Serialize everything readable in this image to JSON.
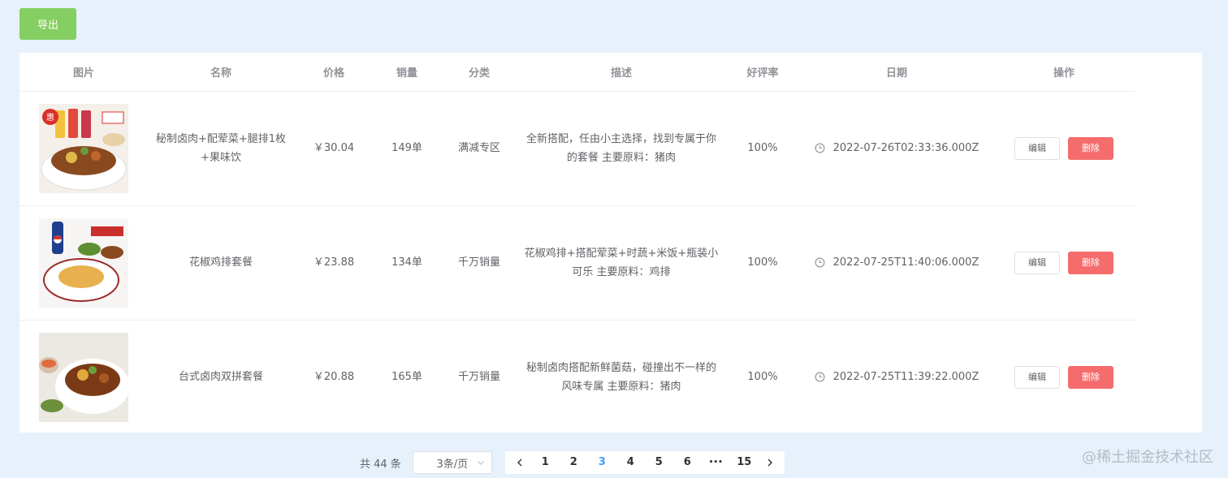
{
  "toolbar": {
    "export_label": "导出"
  },
  "table": {
    "headers": [
      "图片",
      "名称",
      "价格",
      "销量",
      "分类",
      "描述",
      "好评率",
      "日期",
      "操作"
    ],
    "rows": [
      {
        "image_icon": "food-combo-image",
        "name": "秘制卤肉+配荤菜+腿排1枚+果味饮",
        "price": "￥30.04",
        "sales": "149单",
        "category": "满减专区",
        "description": "全新搭配，任由小主选择，找到专属于你的套餐 主要原料：猪肉",
        "rating": "100%",
        "date": "2022-07-26T02:33:36.000Z"
      },
      {
        "image_icon": "chicken-combo-image",
        "name": "花椒鸡排套餐",
        "price": "￥23.88",
        "sales": "134单",
        "category": "千万销量",
        "description": "花椒鸡排+搭配荤菜+时蔬+米饭+瓶装小可乐 主要原料：鸡排",
        "rating": "100%",
        "date": "2022-07-25T11:40:06.000Z"
      },
      {
        "image_icon": "pork-combo-image",
        "name": "台式卤肉双拼套餐",
        "price": "￥20.88",
        "sales": "165单",
        "category": "千万销量",
        "description": "秘制卤肉搭配新鲜菌菇，碰撞出不一样的风味专属 主要原料：猪肉",
        "rating": "100%",
        "date": "2022-07-25T11:39:22.000Z"
      }
    ],
    "edit_label": "编辑",
    "delete_label": "删除"
  },
  "pagination": {
    "total_text": "共 44 条",
    "page_size": "3条/页",
    "pages": [
      "1",
      "2",
      "3",
      "4",
      "5",
      "6",
      "•••",
      "15"
    ],
    "current": "3"
  },
  "watermark": "@稀土掘金技术社区",
  "colors": {
    "export": "#85ce61",
    "delete": "#f56c6c",
    "active_page": "#409eff",
    "background": "#e6f1fb"
  }
}
